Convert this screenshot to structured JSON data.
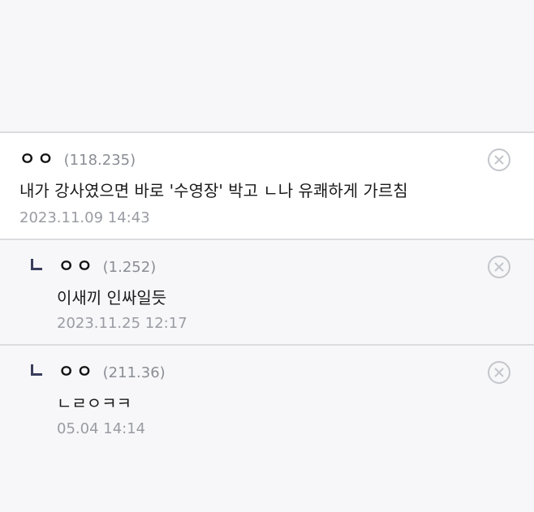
{
  "comments": [
    {
      "nick": "ㅇㅇ",
      "ip": "(118.235)",
      "text": "내가 강사였으면 바로 '수영장' 박고 ㄴ나 유쾌하게 가르침",
      "time": "2023.11.09 14:43",
      "delete_icon": "close-circle-icon"
    },
    {
      "nick": "ㅇㅇ",
      "ip": "(1.252)",
      "text": "이새끼 인싸일듯",
      "time": "2023.11.25 12:17",
      "delete_icon": "close-circle-icon"
    },
    {
      "nick": "ㅇㅇ",
      "ip": "(211.36)",
      "text": "ㄴㄹㅇㅋㅋ",
      "time": "05.04 14:14",
      "delete_icon": "close-circle-icon"
    }
  ],
  "colors": {
    "background": "#f7f7f9",
    "main_comment_bg": "#ffffff",
    "reply_mark": "#3a3d5c",
    "meta_text": "#9a9ca3"
  }
}
